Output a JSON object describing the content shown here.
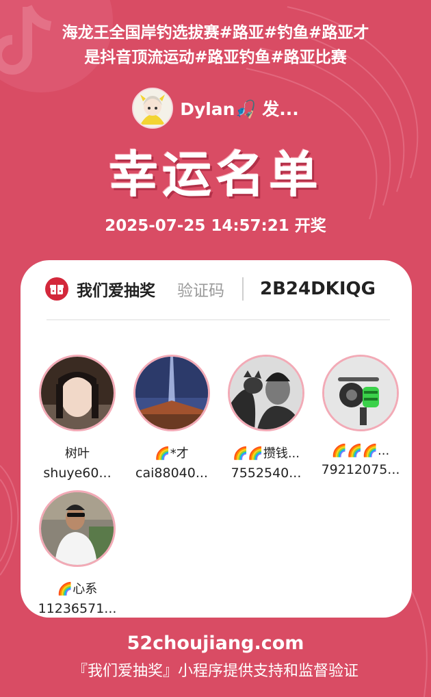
{
  "headline": {
    "line1": "海龙王全国岸钓选拔赛#路亚#钓鱼#路亚才",
    "line2": "是抖音顶流运动#路亚钓鱼#路亚比赛"
  },
  "author": {
    "name": "Dylan🎣 发..."
  },
  "title": "幸运名单",
  "draw_time": "2025-07-25 14:57:21 开奖",
  "card": {
    "platform_name": "我们爱抽奖",
    "verify_label": "验证码",
    "verify_code": "2B24DKIQG",
    "winners": [
      {
        "nickname": "树叶",
        "user_id": "shuye60..."
      },
      {
        "nickname": "🌈*才",
        "user_id": "cai88040..."
      },
      {
        "nickname": "🌈🌈攒钱...",
        "user_id": "7552540..."
      },
      {
        "nickname": "🌈🌈🌈...",
        "user_id": "79212075..."
      },
      {
        "nickname": "🌈心系",
        "user_id": "11236571..."
      }
    ]
  },
  "footer": {
    "site": "52choujiang.com",
    "note": "『我们爱抽奖』小程序提供支持和监督验证"
  },
  "colors": {
    "background": "#d94c64",
    "card": "#ffffff",
    "avatar_ring": "#f2aab6",
    "gift_icon": "#d3283b"
  },
  "icons": [
    "tiktok-logo-watermark",
    "gift-icon"
  ]
}
